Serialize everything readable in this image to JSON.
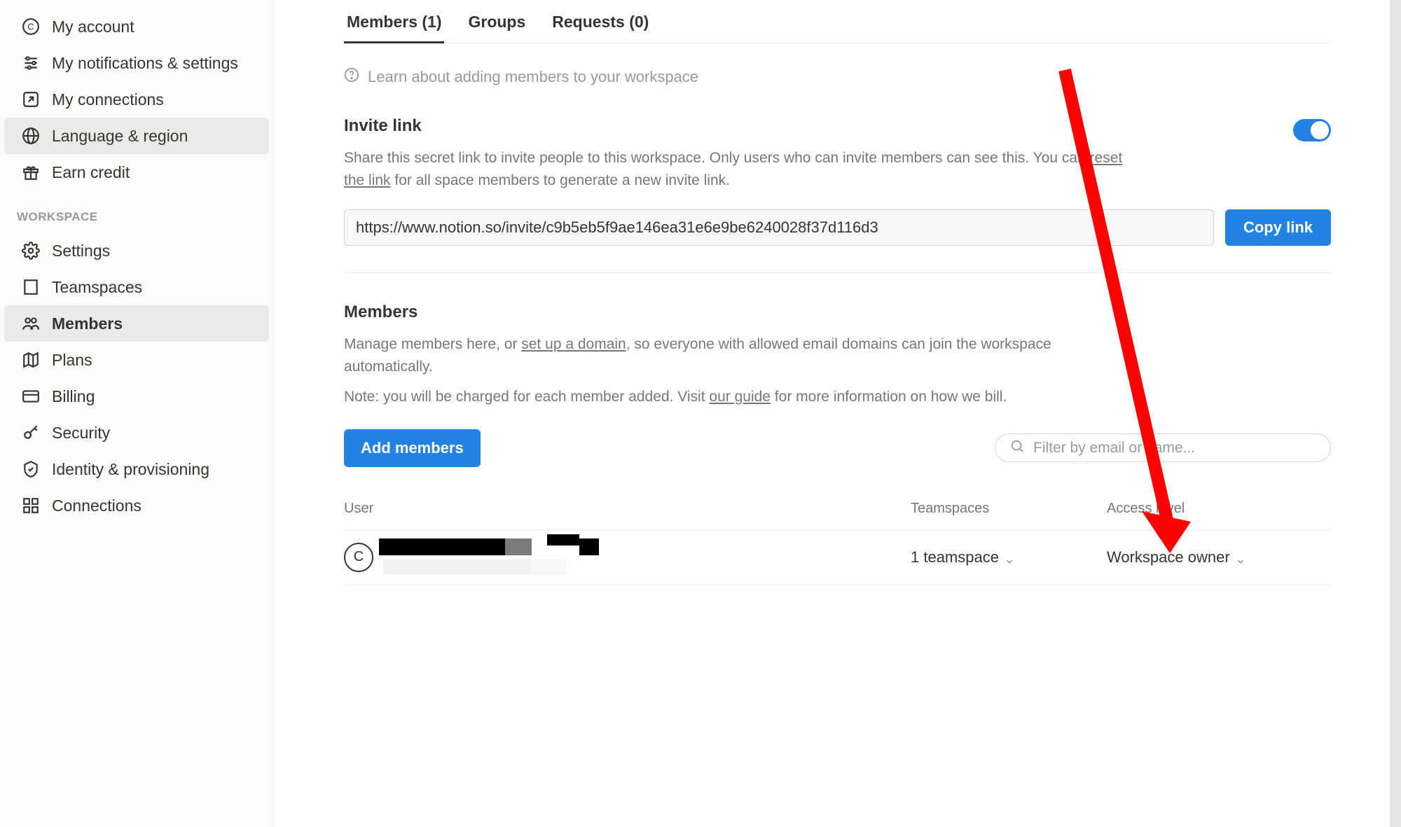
{
  "sidebar": {
    "account_items": [
      {
        "label": "My account"
      },
      {
        "label": "My notifications & settings"
      },
      {
        "label": "My connections"
      },
      {
        "label": "Language & region"
      },
      {
        "label": "Earn credit"
      }
    ],
    "workspace_label": "WORKSPACE",
    "workspace_items": [
      {
        "label": "Settings"
      },
      {
        "label": "Teamspaces"
      },
      {
        "label": "Members"
      },
      {
        "label": "Plans"
      },
      {
        "label": "Billing"
      },
      {
        "label": "Security"
      },
      {
        "label": "Identity & provisioning"
      },
      {
        "label": "Connections"
      }
    ]
  },
  "tabs": {
    "members": "Members (1)",
    "groups": "Groups",
    "requests": "Requests (0)"
  },
  "learn": "Learn about adding members to your workspace",
  "invite": {
    "title": "Invite link",
    "desc_part1": "Share this secret link to invite people to this workspace. Only users who can invite members can see this. You can ",
    "reset_link": "reset the link",
    "desc_part2": " for all space members to generate a new invite link.",
    "url": "https://www.notion.so/invite/c9b5eb5f9ae146ea31e6e9be6240028f37d116d3",
    "copy": "Copy link"
  },
  "members": {
    "title": "Members",
    "desc_part1": "Manage members here, or ",
    "domain_link": "set up a domain",
    "desc_part2": ", so everyone with allowed email domains can join the workspace automatically.",
    "note_part1": "Note: you will be charged for each member added. Visit ",
    "guide_link": "our guide",
    "note_part2": " for more information on how we bill.",
    "add_btn": "Add members",
    "filter_placeholder": "Filter by email or name...",
    "columns": {
      "user": "User",
      "teamspaces": "Teamspaces",
      "access": "Access level"
    },
    "rows": [
      {
        "avatar_letter": "C",
        "teamspaces": "1 teamspace",
        "access": "Workspace owner"
      }
    ]
  }
}
